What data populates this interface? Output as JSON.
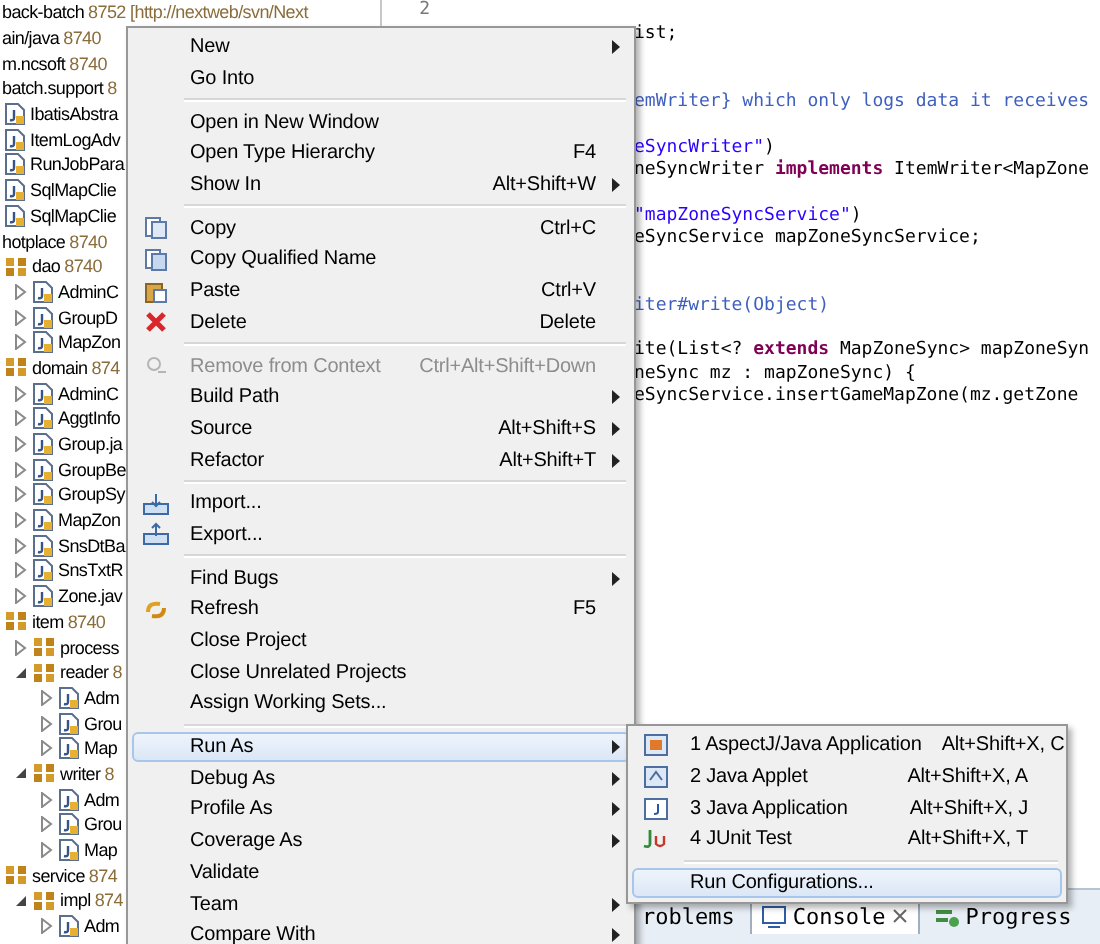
{
  "tree": {
    "items": [
      {
        "kind": "label",
        "label": "back-batch",
        "count": "8752 [http://nextweb/svn/Next"
      },
      {
        "kind": "label",
        "label": "ain/java",
        "count": "8740"
      },
      {
        "kind": "label",
        "label": "m.ncsoft",
        "count": "8740"
      },
      {
        "kind": "label",
        "label": "batch.support",
        "count": "8",
        "children": [
          {
            "kind": "class",
            "label": "IbatisAbstra"
          },
          {
            "kind": "class",
            "label": "ItemLogAdv"
          },
          {
            "kind": "class",
            "label": "RunJobPara"
          },
          {
            "kind": "class",
            "label": "SqlMapClie"
          },
          {
            "kind": "class",
            "label": "SqlMapClie"
          }
        ]
      },
      {
        "kind": "label",
        "label": "hotplace",
        "count": "8740",
        "children": [
          {
            "kind": "package",
            "label": "dao",
            "count": "8740",
            "children": [
              {
                "kind": "class",
                "label": "AdminC",
                "expanded": false
              },
              {
                "kind": "class",
                "label": "GroupD",
                "expanded": false
              },
              {
                "kind": "class",
                "label": "MapZon",
                "expanded": false
              }
            ]
          },
          {
            "kind": "package",
            "label": "domain",
            "count": "874",
            "children": [
              {
                "kind": "class",
                "label": "AdminC",
                "expanded": false
              },
              {
                "kind": "class",
                "label": "AggtInfo",
                "expanded": false
              },
              {
                "kind": "class",
                "label": "Group.ja",
                "expanded": false
              },
              {
                "kind": "class",
                "label": "GroupBe",
                "expanded": false
              },
              {
                "kind": "class",
                "label": "GroupSy",
                "expanded": false
              },
              {
                "kind": "class",
                "label": "MapZon",
                "expanded": false
              },
              {
                "kind": "class",
                "label": "SnsDtBa",
                "expanded": false
              },
              {
                "kind": "class",
                "label": "SnsTxtR",
                "expanded": false
              },
              {
                "kind": "class",
                "label": "Zone.jav",
                "expanded": false
              }
            ]
          },
          {
            "kind": "package",
            "label": "item",
            "count": "8740",
            "children": [
              {
                "kind": "package",
                "label": "process",
                "expanded": false
              },
              {
                "kind": "package",
                "label": "reader",
                "count": "8",
                "expanded": true,
                "children": [
                  {
                    "kind": "class",
                    "label": "Adm",
                    "expanded": false
                  },
                  {
                    "kind": "class",
                    "label": "Grou",
                    "expanded": false
                  },
                  {
                    "kind": "class",
                    "label": "Map",
                    "expanded": false
                  }
                ]
              },
              {
                "kind": "package",
                "label": "writer",
                "count": "8",
                "expanded": true,
                "children": [
                  {
                    "kind": "class",
                    "label": "Adm",
                    "expanded": false
                  },
                  {
                    "kind": "class",
                    "label": "Grou",
                    "expanded": false
                  },
                  {
                    "kind": "class",
                    "label": "Map",
                    "expanded": false
                  }
                ]
              }
            ]
          },
          {
            "kind": "package",
            "label": "service",
            "count": "874",
            "children": [
              {
                "kind": "package",
                "label": "impl",
                "count": "874",
                "expanded": true,
                "children": [
                  {
                    "kind": "class",
                    "label": "Adm",
                    "expanded": false
                  }
                ]
              }
            ]
          }
        ]
      }
    ]
  },
  "editor": {
    "line_number": "2",
    "lines": [
      {
        "kind": "blank"
      },
      {
        "kind": "code",
        "parts": [
          {
            "kind": "plain",
            "text": "ist;"
          }
        ]
      },
      {
        "kind": "blank"
      },
      {
        "kind": "blank"
      },
      {
        "kind": "code",
        "parts": [
          {
            "kind": "doc",
            "text": "emWriter} which only logs data it receives"
          }
        ]
      },
      {
        "kind": "blank"
      },
      {
        "kind": "code",
        "parts": [
          {
            "kind": "string",
            "text": "eSyncWriter\""
          },
          {
            "kind": "plain",
            "text": ")"
          }
        ]
      },
      {
        "kind": "code",
        "parts": [
          {
            "kind": "plain",
            "text": "neSyncWriter "
          },
          {
            "kind": "keyword",
            "text": "implements"
          },
          {
            "kind": "plain",
            "text": " ItemWriter<MapZone"
          }
        ]
      },
      {
        "kind": "blank"
      },
      {
        "kind": "code",
        "parts": [
          {
            "kind": "string",
            "text": "\"mapZoneSyncService\""
          },
          {
            "kind": "plain",
            "text": ")"
          }
        ]
      },
      {
        "kind": "code",
        "parts": [
          {
            "kind": "plain",
            "text": "eSyncService mapZoneSyncService;"
          }
        ]
      },
      {
        "kind": "blank"
      },
      {
        "kind": "blank"
      },
      {
        "kind": "code",
        "parts": [
          {
            "kind": "doc",
            "text": "iter#write(Object)"
          }
        ]
      },
      {
        "kind": "blank"
      },
      {
        "kind": "code",
        "parts": [
          {
            "kind": "plain",
            "text": "ite(List<? "
          },
          {
            "kind": "keyword",
            "text": "extends"
          },
          {
            "kind": "plain",
            "text": " MapZoneSync> mapZoneSyn"
          }
        ]
      },
      {
        "kind": "code",
        "parts": [
          {
            "kind": "plain",
            "text": "neSync mz : mapZoneSync) {"
          }
        ]
      },
      {
        "kind": "code",
        "parts": [
          {
            "kind": "plain",
            "text": "eSyncService.insertGameMapZone(mz.getZone"
          }
        ]
      }
    ]
  },
  "bottom_tabs": [
    {
      "label": "roblems",
      "selected": false
    },
    {
      "label": "Console",
      "selected": true,
      "closable": true
    },
    {
      "label": "Progress",
      "selected": false
    }
  ],
  "context_menu": {
    "groups": [
      [
        {
          "label": "New",
          "submenu": true
        },
        {
          "label": "Go Into"
        }
      ],
      [
        {
          "label": "Open in New Window"
        },
        {
          "label": "Open Type Hierarchy",
          "shortcut": "F4"
        },
        {
          "label": "Show In",
          "shortcut": "Alt+Shift+W",
          "submenu": true
        }
      ],
      [
        {
          "label": "Copy",
          "shortcut": "Ctrl+C"
        },
        {
          "label": "Copy Qualified Name"
        },
        {
          "label": "Paste",
          "shortcut": "Ctrl+V"
        },
        {
          "label": "Delete",
          "shortcut": "Delete"
        }
      ],
      [
        {
          "label": "Remove from Context",
          "shortcut": "Ctrl+Alt+Shift+Down",
          "disabled": true
        },
        {
          "label": "Build Path",
          "submenu": true
        },
        {
          "label": "Source",
          "shortcut": "Alt+Shift+S",
          "submenu": true
        },
        {
          "label": "Refactor",
          "shortcut": "Alt+Shift+T",
          "submenu": true
        }
      ],
      [
        {
          "label": "Import..."
        },
        {
          "label": "Export..."
        }
      ],
      [
        {
          "label": "Find Bugs",
          "submenu": true
        },
        {
          "label": "Refresh",
          "shortcut": "F5"
        },
        {
          "label": "Close Project"
        },
        {
          "label": "Close Unrelated Projects"
        },
        {
          "label": "Assign Working Sets..."
        }
      ],
      [
        {
          "label": "Run As",
          "submenu": true,
          "selected": true
        },
        {
          "label": "Debug As",
          "submenu": true,
          "selected": false
        },
        {
          "label": "Profile As",
          "submenu": true,
          "selected": false
        },
        {
          "label": "Coverage As",
          "submenu": true,
          "selected": false
        },
        {
          "label": "Validate",
          "selected": false
        },
        {
          "label": "Team",
          "submenu": true,
          "selected": false
        },
        {
          "label": "Compare With",
          "submenu": true,
          "selected": false
        }
      ]
    ]
  },
  "run_as_submenu": {
    "groups": [
      [
        {
          "label": "1 AspectJ/Java Application",
          "shortcut": "Alt+Shift+X, C",
          "selected": false
        },
        {
          "label": "2 Java Applet",
          "shortcut": "Alt+Shift+X, A",
          "selected": false
        },
        {
          "label": "3 Java Application",
          "shortcut": "Alt+Shift+X, J",
          "selected": false
        },
        {
          "label": "4 JUnit Test",
          "shortcut": "Alt+Shift+X, T",
          "selected": false
        }
      ],
      [
        {
          "label": "Run Configurations...",
          "selected": true
        }
      ]
    ]
  }
}
